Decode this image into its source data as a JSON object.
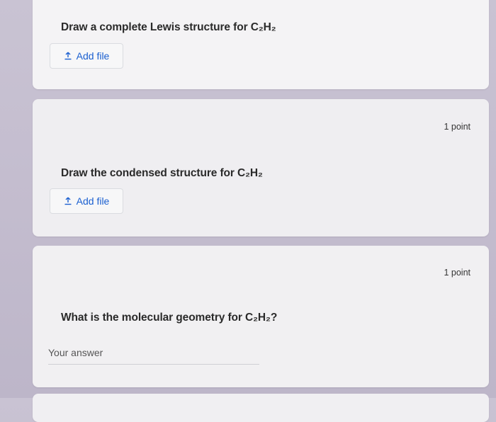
{
  "questions": [
    {
      "text": "Draw a complete Lewis structure for C₂H₂",
      "upload_label": "Add file"
    },
    {
      "points": "1 point",
      "text": "Draw the condensed structure for C₂H₂",
      "upload_label": "Add file"
    },
    {
      "points": "1 point",
      "text": "What is the molecular geometry for C₂H₂?",
      "answer_placeholder": "Your answer"
    }
  ],
  "colors": {
    "accent": "#1a5fd0",
    "card_bg": "#f2f1f3",
    "page_bg": "#c5becf"
  },
  "icons": {
    "upload": "upload-icon"
  }
}
